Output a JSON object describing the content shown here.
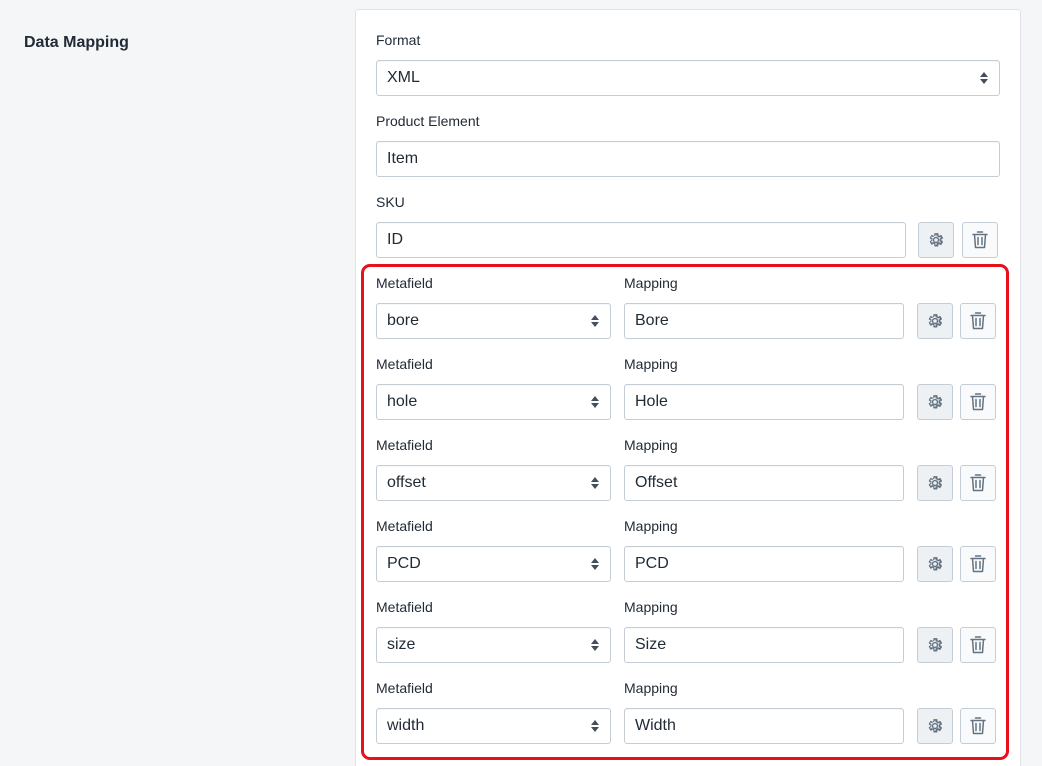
{
  "section": {
    "title": "Data Mapping"
  },
  "format": {
    "label": "Format",
    "value": "XML"
  },
  "product_element": {
    "label": "Product Element",
    "value": "Item"
  },
  "sku": {
    "label": "SKU",
    "value": "ID"
  },
  "mapping_rows": [
    {
      "metafield_label": "Metafield",
      "metafield_value": "bore",
      "mapping_label": "Mapping",
      "mapping_value": "Bore"
    },
    {
      "metafield_label": "Metafield",
      "metafield_value": "hole",
      "mapping_label": "Mapping",
      "mapping_value": "Hole"
    },
    {
      "metafield_label": "Metafield",
      "metafield_value": "offset",
      "mapping_label": "Mapping",
      "mapping_value": "Offset"
    },
    {
      "metafield_label": "Metafield",
      "metafield_value": "PCD",
      "mapping_label": "Mapping",
      "mapping_value": "PCD"
    },
    {
      "metafield_label": "Metafield",
      "metafield_value": "size",
      "mapping_label": "Mapping",
      "mapping_value": "Size"
    },
    {
      "metafield_label": "Metafield",
      "metafield_value": "width",
      "mapping_label": "Mapping",
      "mapping_value": "Width"
    }
  ],
  "icons": {
    "settings": "gear-icon",
    "delete": "trash-icon",
    "select": "chevron-updown-icon"
  },
  "colors": {
    "highlight": "#e8101a",
    "border": "#c4cdd5",
    "page_bg": "#f4f6f8"
  }
}
